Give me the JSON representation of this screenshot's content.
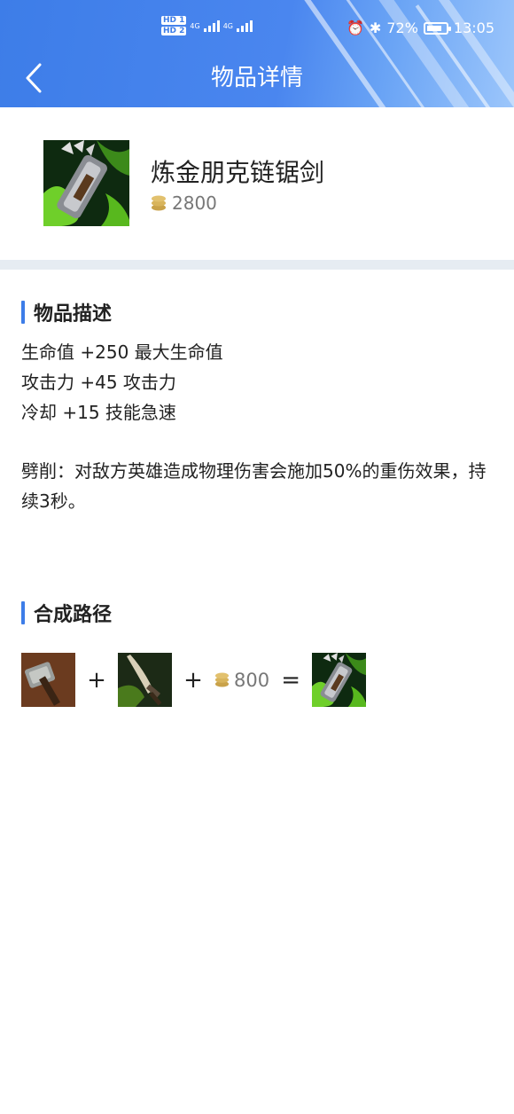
{
  "status_bar": {
    "sim1": "HD 1",
    "sim2": "HD 2",
    "network1": "4G",
    "network2": "4G",
    "battery": "72%",
    "time": "13:05"
  },
  "header": {
    "title": "物品详情",
    "back_icon": "chevron-left-icon"
  },
  "item": {
    "name": "炼金朋克链锯剑",
    "price": "2800"
  },
  "description": {
    "section_title": "物品描述",
    "stats": [
      "生命值 +250 最大生命值",
      "攻击力 +45 攻击力",
      "冷却 +15 技能急速"
    ],
    "passive": "劈削：对敌方英雄造成物理伤害会施加50%的重伤效果，持续3秒。"
  },
  "recipe": {
    "section_title": "合成路径",
    "plus1": "+",
    "plus2": "+",
    "gold_cost": "800",
    "equals": "="
  },
  "colors": {
    "accent": "#3d7de8",
    "divider": "#e6ecf2",
    "coin": "#c9a24a"
  }
}
